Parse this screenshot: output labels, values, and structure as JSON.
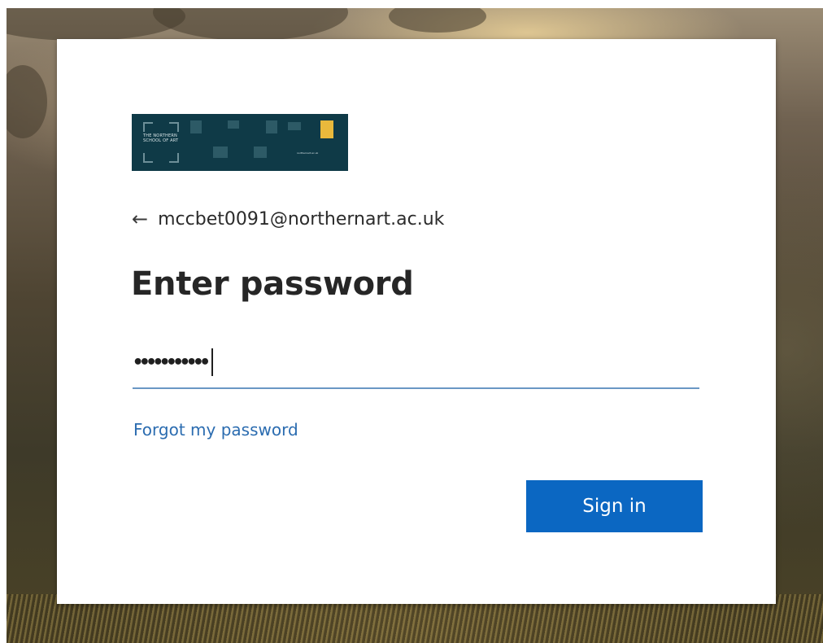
{
  "colors": {
    "background_top": "#9a8b74",
    "background_bottom": "#4b4326",
    "card": "#ffffff",
    "logo_background": "#0f3a47",
    "logo_badge": "#e9b93c",
    "title_text": "#262626",
    "link": "#2b6cb0",
    "input_underline": "#6a97c4",
    "primary_button": "#0b67c2",
    "primary_button_text": "#ffffff"
  },
  "logo": {
    "school_name": "THE NORTHERN SCHOOL OF ART",
    "website": "northernart.ac.uk"
  },
  "back": {
    "icon": "back-arrow-icon",
    "glyph": "←",
    "email": "mccbet0091@northernart.ac.uk"
  },
  "heading": {
    "title": "Enter password"
  },
  "password": {
    "masked_value": "•••••••••••"
  },
  "links": {
    "forgot_password": "Forgot my password"
  },
  "buttons": {
    "sign_in": "Sign in"
  }
}
